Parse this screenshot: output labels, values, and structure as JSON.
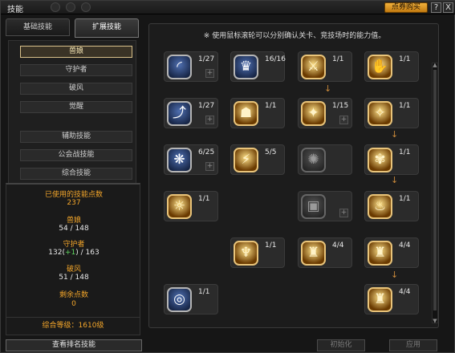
{
  "window": {
    "title": "技能",
    "shop_label": "点券购买",
    "help_icon": "?",
    "close_icon": "X"
  },
  "tabs": [
    {
      "label": "基础技能",
      "active": false
    },
    {
      "label": "扩展技能",
      "active": true
    }
  ],
  "categories": [
    {
      "label": "兽娘",
      "selected": true
    },
    {
      "label": "守护者",
      "selected": false
    },
    {
      "label": "破风",
      "selected": false
    },
    {
      "label": "觉醒",
      "selected": false
    },
    {
      "label": "辅助技能",
      "selected": false
    },
    {
      "label": "公会战技能",
      "selected": false
    },
    {
      "label": "综合技能",
      "selected": false
    }
  ],
  "stats": {
    "used_points_label": "已使用的技能点数",
    "used_points_value": "237",
    "beast_label": "兽娘",
    "beast_value": "54 / 148",
    "guardian_label": "守护者",
    "guardian_value_a": "132(",
    "guardian_bonus": "+1",
    "guardian_value_b": ") / 163",
    "breaker_label": "破风",
    "breaker_value": "51 / 148",
    "remaining_label": "剩余点数",
    "remaining_value": "0",
    "overall_level": "综合等级：1610级"
  },
  "rank_button": "查看排名技能",
  "hint": "※ 使用鼠标滚轮可以分别确认关卡、竞技场时的能力值。",
  "skills": [
    {
      "name": "skill-1",
      "level": "1/27",
      "style": "blue",
      "glyph": "◜",
      "plus": true
    },
    {
      "name": "skill-2",
      "level": "16/16",
      "style": "blue",
      "glyph": "♛",
      "plus": false
    },
    {
      "name": "skill-3",
      "level": "1/1",
      "style": "gold",
      "glyph": "⚔",
      "plus": false
    },
    {
      "name": "skill-4",
      "level": "1/1",
      "style": "gold",
      "glyph": "✋",
      "plus": false
    },
    {
      "name": "skill-5",
      "level": "1/27",
      "style": "blue",
      "glyph": "⤴",
      "plus": true
    },
    {
      "name": "skill-6",
      "level": "1/1",
      "style": "gold",
      "glyph": "☗",
      "plus": false
    },
    {
      "name": "skill-7",
      "level": "1/15",
      "style": "gold",
      "glyph": "✦",
      "plus": true
    },
    {
      "name": "skill-8",
      "level": "1/1",
      "style": "gold",
      "glyph": "✧",
      "plus": false
    },
    {
      "name": "skill-9",
      "level": "6/25",
      "style": "blue",
      "glyph": "❋",
      "plus": true
    },
    {
      "name": "skill-10",
      "level": "5/5",
      "style": "gold",
      "glyph": "⚡",
      "plus": false
    },
    {
      "name": "skill-11",
      "level": "",
      "style": "dim",
      "glyph": "✺",
      "plus": false
    },
    {
      "name": "skill-12",
      "level": "1/1",
      "style": "gold",
      "glyph": "✾",
      "plus": false
    },
    {
      "name": "skill-13",
      "level": "1/1",
      "style": "gold",
      "glyph": "☼",
      "plus": false
    },
    {
      "name": "skill-14",
      "level": "",
      "style": "dim",
      "glyph": "▣",
      "plus": true
    },
    {
      "name": "skill-15",
      "level": "1/1",
      "style": "gold",
      "glyph": "♨",
      "plus": false
    },
    {
      "name": "skill-16",
      "level": "1/1",
      "style": "gold",
      "glyph": "♆",
      "plus": false
    },
    {
      "name": "skill-17",
      "level": "4/4",
      "style": "gold",
      "glyph": "♜",
      "plus": false
    },
    {
      "name": "skill-18",
      "level": "4/4",
      "style": "gold",
      "glyph": "♜",
      "plus": false
    },
    {
      "name": "skill-19",
      "level": "1/1",
      "style": "blue",
      "glyph": "◎",
      "plus": false
    },
    {
      "name": "skill-20",
      "level": "4/4",
      "style": "gold",
      "glyph": "♜",
      "plus": false
    }
  ],
  "buttons": {
    "reset": "初始化",
    "apply": "应用"
  },
  "colors": {
    "accent_gold": "#f2a52a",
    "bonus_green": "#5fd35f"
  }
}
